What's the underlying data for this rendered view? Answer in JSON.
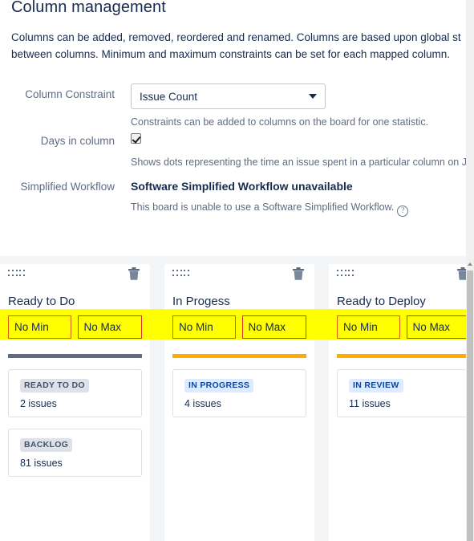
{
  "page": {
    "title": "Column management",
    "description_line1": "Columns can be added, removed, reordered and renamed. Columns are based upon global st",
    "description_line2": "between columns. Minimum and maximum constraints can be set for each mapped column."
  },
  "form": {
    "column_constraint": {
      "label": "Column Constraint",
      "value": "Issue Count",
      "help": "Constraints can be added to columns on the board for one statistic.",
      "options": [
        "Issue Count"
      ]
    },
    "days_in_column": {
      "label": "Days in column",
      "checked": true,
      "help": "Shows dots representing the time an issue spent in a particular column on Jira bo"
    },
    "simplified_workflow": {
      "label": "Simplified Workflow",
      "value": "Software Simplified Workflow unavailable",
      "help": "This board is unable to use a Software Simplified Workflow.",
      "help_icon": "question-mark-icon"
    }
  },
  "board": {
    "columns": [
      {
        "title": "Ready to Do",
        "min_label": "No Min",
        "max_label": "No Max",
        "bar_color": "#5e6c84",
        "drag_handle_icon": "drag-handle-icon",
        "delete_icon": "trash-icon",
        "statuses": [
          {
            "name": "READY TO DO",
            "issues": "2 issues",
            "style": "gray"
          },
          {
            "name": "BACKLOG",
            "issues": "81 issues",
            "style": "gray"
          }
        ]
      },
      {
        "title": "In Progess",
        "min_label": "No Min",
        "max_label": "No Max",
        "bar_color": "#ffab00",
        "drag_handle_icon": "drag-handle-icon",
        "delete_icon": "trash-icon",
        "statuses": [
          {
            "name": "IN PROGRESS",
            "issues": "4 issues",
            "style": "blue"
          }
        ]
      },
      {
        "title": "Ready to Deploy",
        "min_label": "No Min",
        "max_label": "No Max",
        "bar_color": "#ffab00",
        "drag_handle_icon": "drag-handle-icon",
        "delete_icon": "trash-icon",
        "statuses": [
          {
            "name": "IN REVIEW",
            "issues": "11 issues",
            "style": "blue"
          }
        ]
      }
    ]
  },
  "colors": {
    "highlight": "#ffff00",
    "min_border": "#e8590c",
    "max_border": "#e03131",
    "orange_bar": "#ffab00",
    "slate_bar": "#5e6c84",
    "text": "#172b4d",
    "muted": "#5e6c84"
  }
}
